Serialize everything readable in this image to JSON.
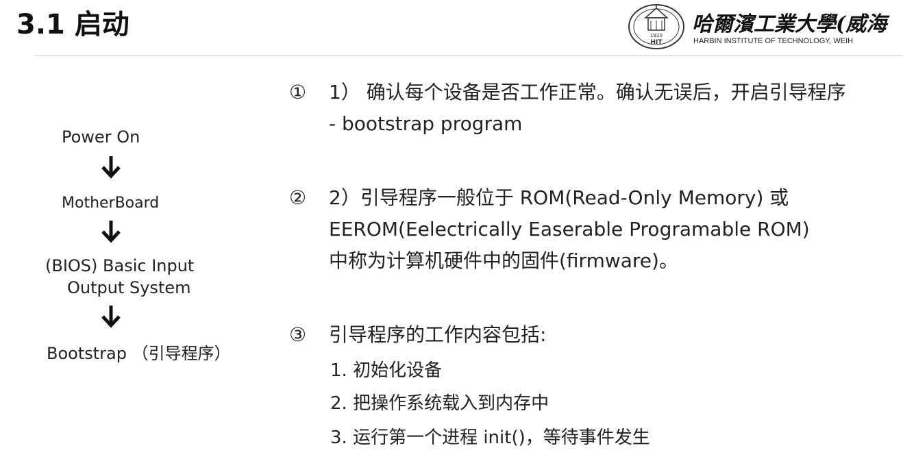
{
  "header": {
    "title": "3.1 启动",
    "logo": {
      "name": "哈爾濱工業大學(威海",
      "english": "HARBIN INSTITUTE OF TECHNOLOGY, WEIH",
      "seal_text": "HIT",
      "seal_year": "1920"
    }
  },
  "flowchart": {
    "steps": [
      {
        "line1": "Power On"
      },
      {
        "line1": "MotherBoard"
      },
      {
        "line1": "(BIOS) Basic Input",
        "line2": "Output System"
      },
      {
        "line1": "Bootstrap （引导程序）"
      }
    ]
  },
  "content": {
    "items": [
      {
        "marker": "①",
        "lines": [
          "1） 确认每个设备是否工作正常。确认无误后，开启引导程序",
          "- bootstrap program"
        ]
      },
      {
        "marker": "②",
        "lines": [
          "2）引导程序一般位于 ROM(Read-Only Memory) 或",
          "EEROM(Eelectrically Easerable Programable ROM)",
          "中称为计算机硬件中的固件(firmware)。"
        ]
      },
      {
        "marker": "③",
        "lines": [
          "引导程序的工作内容包括:"
        ],
        "subitems": [
          "1. 初始化设备",
          "2. 把操作系统载入到内存中",
          "3. 运行第一个进程 init()，等待事件发生"
        ]
      }
    ]
  }
}
